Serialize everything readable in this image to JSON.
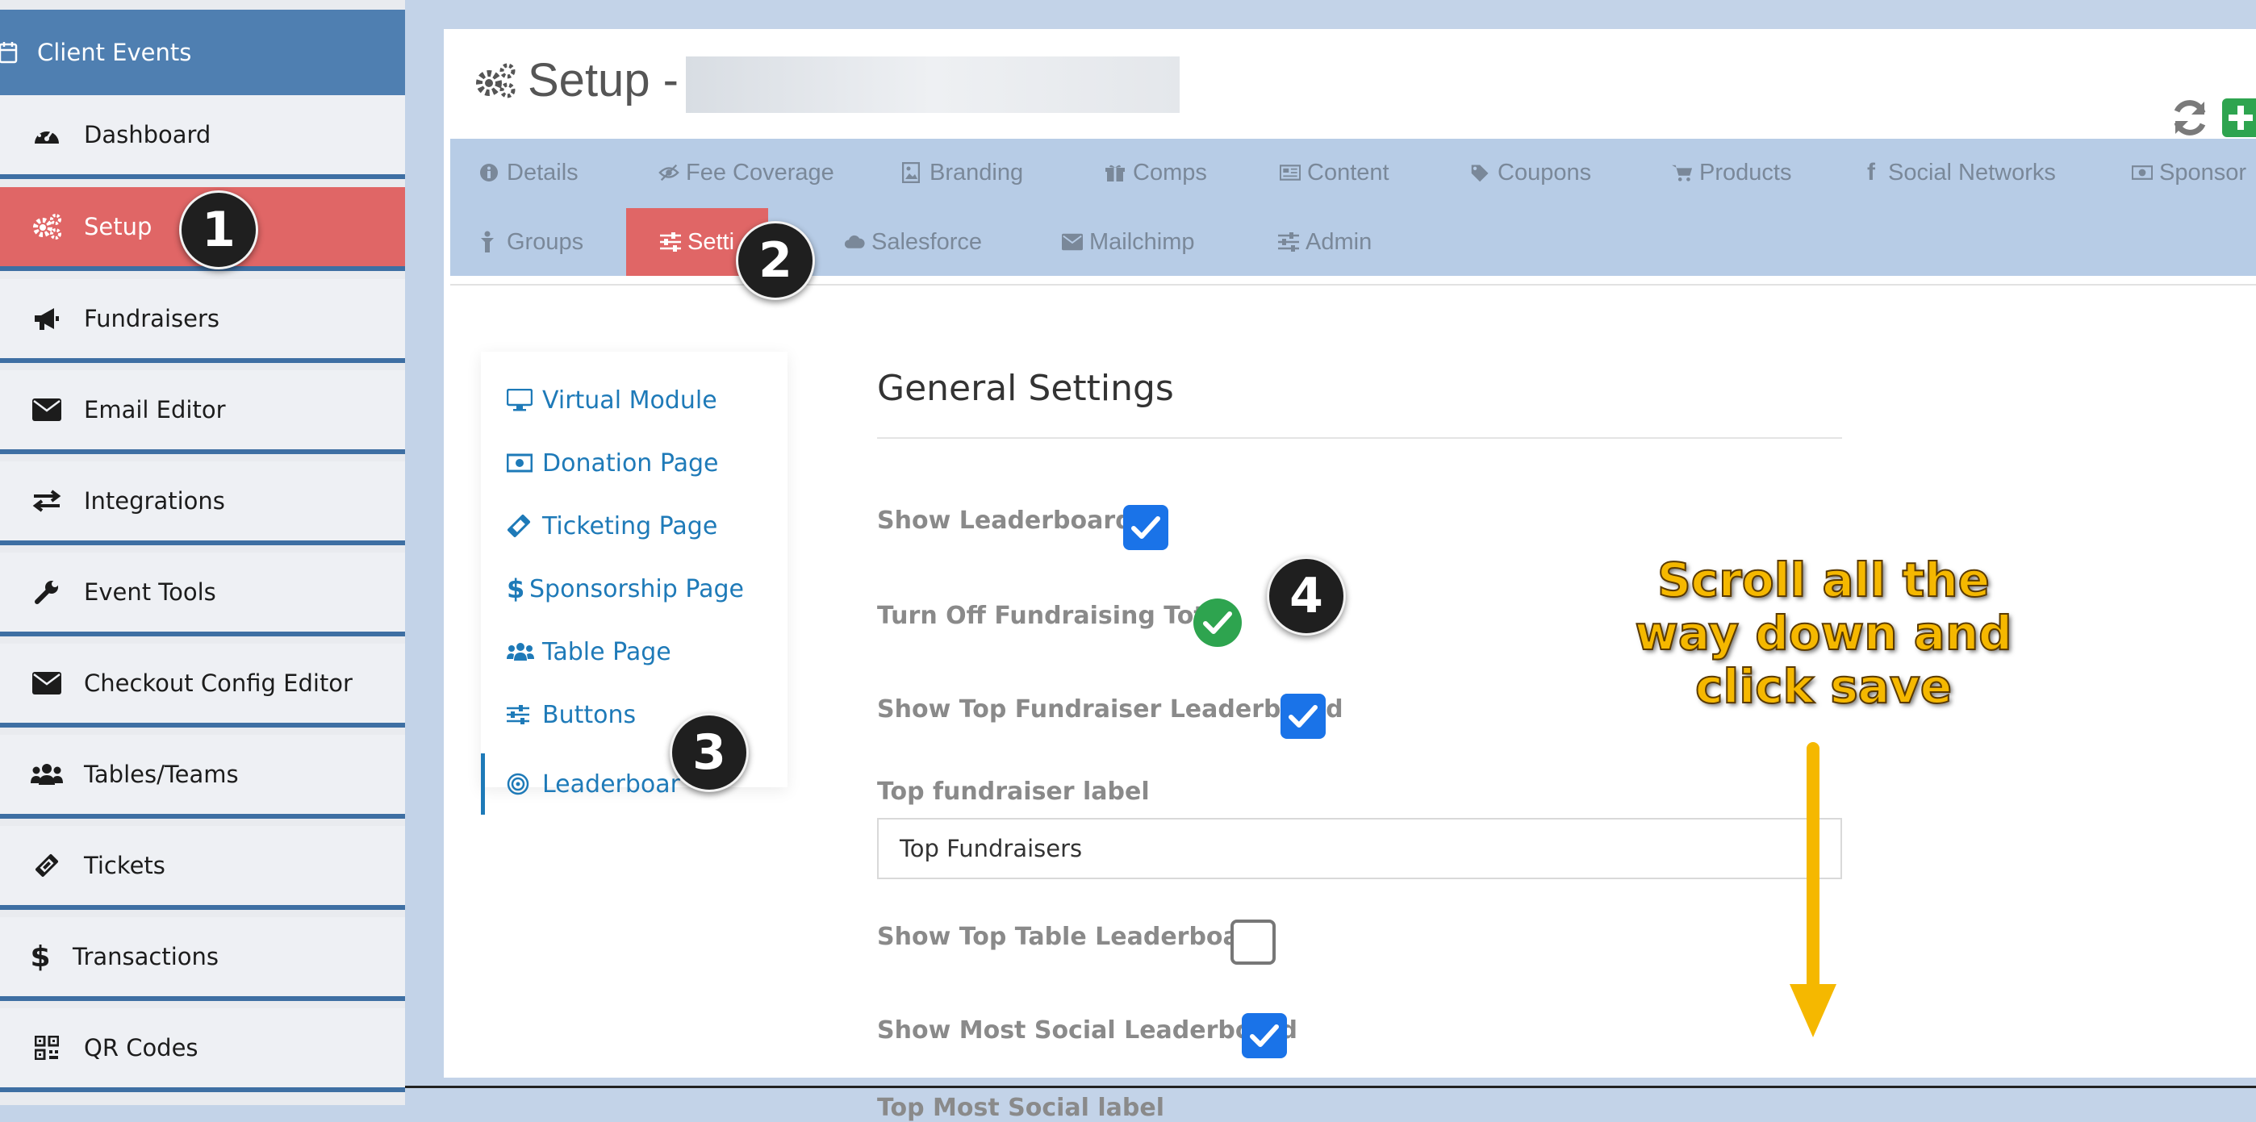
{
  "sidebar": {
    "header": "Client Events",
    "items": [
      {
        "label": "Dashboard",
        "icon": "dashboard-icon"
      },
      {
        "label": "Setup",
        "icon": "gears-icon"
      },
      {
        "label": "Fundraisers",
        "icon": "megaphone-icon"
      },
      {
        "label": "Email Editor",
        "icon": "envelope-icon"
      },
      {
        "label": "Integrations",
        "icon": "exchange-icon"
      },
      {
        "label": "Event Tools",
        "icon": "wrench-icon"
      },
      {
        "label": "Checkout Config Editor",
        "icon": "envelope-icon"
      },
      {
        "label": "Tables/Teams",
        "icon": "users-icon"
      },
      {
        "label": "Tickets",
        "icon": "ticket-icon"
      },
      {
        "label": "Transactions",
        "icon": "dollar-icon"
      },
      {
        "label": "QR Codes",
        "icon": "qrcode-icon"
      }
    ]
  },
  "header": {
    "title": "Setup - '"
  },
  "tabs": {
    "row1": [
      {
        "label": "Details",
        "icon": "info-icon"
      },
      {
        "label": "Fee Coverage",
        "icon": "eye-slash-icon"
      },
      {
        "label": "Branding",
        "icon": "image-icon"
      },
      {
        "label": "Comps",
        "icon": "gift-icon"
      },
      {
        "label": "Content",
        "icon": "newspaper-icon"
      },
      {
        "label": "Coupons",
        "icon": "tags-icon"
      },
      {
        "label": "Products",
        "icon": "cart-icon"
      },
      {
        "label": "Social Networks",
        "icon": "facebook-icon"
      },
      {
        "label": "Sponsor",
        "icon": "money-icon"
      }
    ],
    "row2": [
      {
        "label": "Groups",
        "icon": "child-icon"
      },
      {
        "label": "Setti",
        "icon": "sliders-icon"
      },
      {
        "label": "Salesforce",
        "icon": "cloud-icon"
      },
      {
        "label": "Mailchimp",
        "icon": "envelope-icon"
      },
      {
        "label": "Admin",
        "icon": "sliders-icon"
      }
    ]
  },
  "subnav": [
    {
      "label": "Virtual Module",
      "icon": "desktop-icon"
    },
    {
      "label": "Donation Page",
      "icon": "money-icon"
    },
    {
      "label": "Ticketing Page",
      "icon": "ticket-icon"
    },
    {
      "label": "Sponsorship Page",
      "icon": "dollar-icon"
    },
    {
      "label": "Table Page",
      "icon": "users-icon"
    },
    {
      "label": "Buttons",
      "icon": "sliders-icon"
    },
    {
      "label": "Leaderboar",
      "icon": "bullseye-icon"
    }
  ],
  "settings": {
    "title": "General Settings",
    "show_leaderboards": {
      "label": "Show Leaderboards",
      "checked": true
    },
    "turn_off_total": {
      "label": "Turn Off Fundraising Total",
      "checked": true
    },
    "show_top_fundraiser": {
      "label": "Show Top Fundraiser Leaderboard",
      "checked": true
    },
    "top_fundraiser_label": {
      "label": "Top fundraiser label",
      "value": "Top Fundraisers"
    },
    "show_top_table": {
      "label": "Show Top Table Leaderboard",
      "checked": false
    },
    "show_most_social": {
      "label": "Show Most Social Leaderboard",
      "checked": true
    },
    "top_most_social_label": {
      "label": "Top Most Social label"
    }
  },
  "annotations": {
    "badges": [
      "1",
      "2",
      "3",
      "4"
    ],
    "callout": "Scroll all the way down and click save",
    "arrow_color": "#f5b800"
  },
  "colors": {
    "sidebar_header": "#4f7fb1",
    "active": "#e06666",
    "checkbox": "#1a73e8",
    "link": "#1e7ab8",
    "success": "#2ea44f"
  }
}
